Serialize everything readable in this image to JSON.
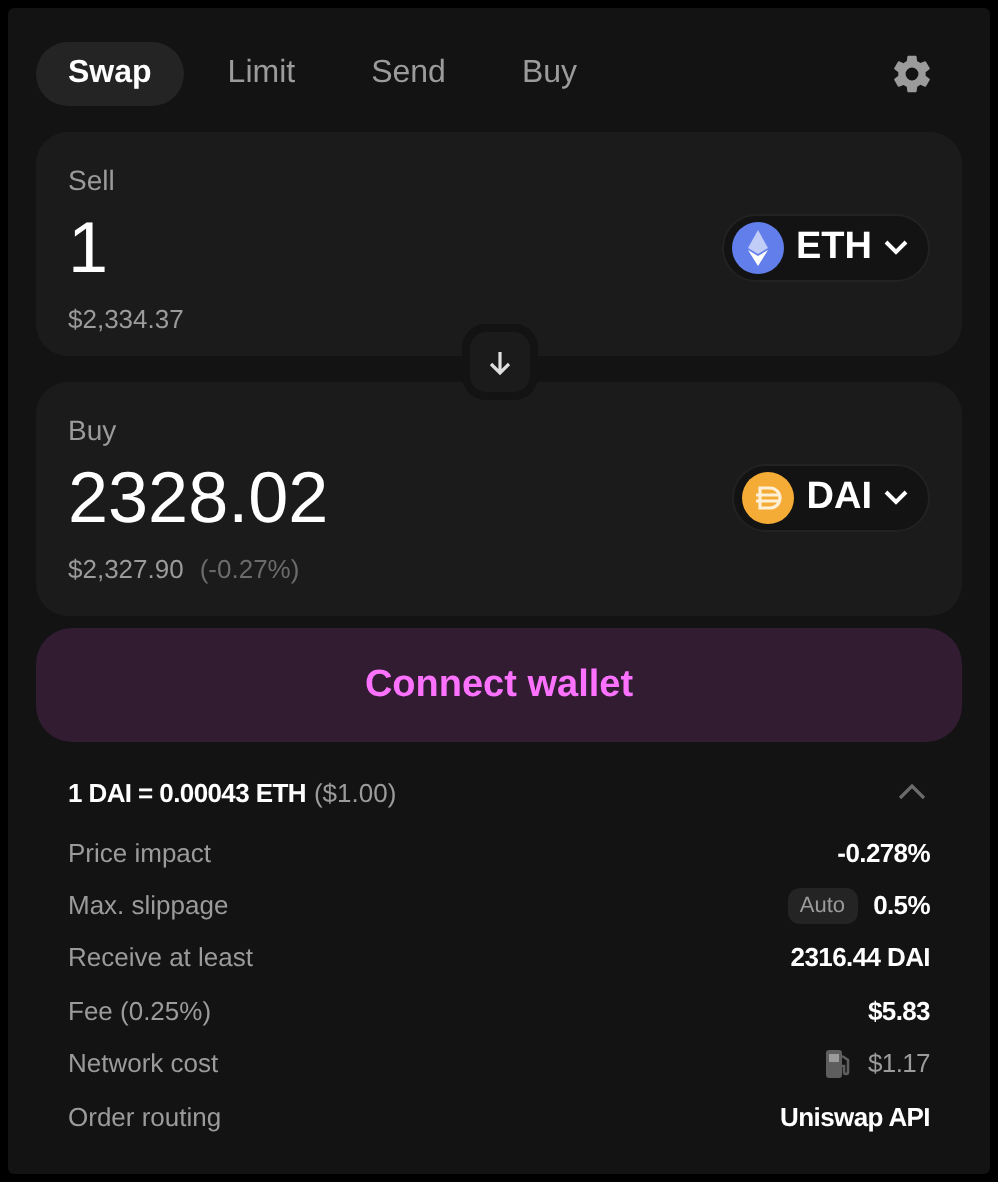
{
  "tabs": [
    {
      "label": "Swap",
      "selected": true
    },
    {
      "label": "Limit",
      "selected": false
    },
    {
      "label": "Send",
      "selected": false
    },
    {
      "label": "Buy",
      "selected": false
    }
  ],
  "sell": {
    "label": "Sell",
    "amount": "1",
    "fiat": "$2,334.37",
    "token": {
      "symbol": "ETH",
      "kind": "eth"
    }
  },
  "buy": {
    "label": "Buy",
    "amount": "2328.02",
    "fiat": "$2,327.90",
    "change": "(-0.27%)",
    "token": {
      "symbol": "DAI",
      "kind": "dai"
    }
  },
  "connect_button": "Connect wallet",
  "rate": {
    "text": "1 DAI = 0.00043 ETH",
    "fiat": "($1.00)",
    "expanded": true
  },
  "details": [
    {
      "kind": "plain",
      "label": "Price impact",
      "value": "-0.278%"
    },
    {
      "kind": "slippage",
      "label": "Max. slippage",
      "badge": "Auto",
      "value": "0.5%"
    },
    {
      "kind": "plain",
      "label": "Receive at least",
      "value": "2316.44 DAI"
    },
    {
      "kind": "plain",
      "label": "Fee (0.25%)",
      "value": "$5.83"
    },
    {
      "kind": "gas",
      "label": "Network cost",
      "value": "$1.17"
    },
    {
      "kind": "plain",
      "label": "Order routing",
      "value": "Uniswap API"
    }
  ]
}
